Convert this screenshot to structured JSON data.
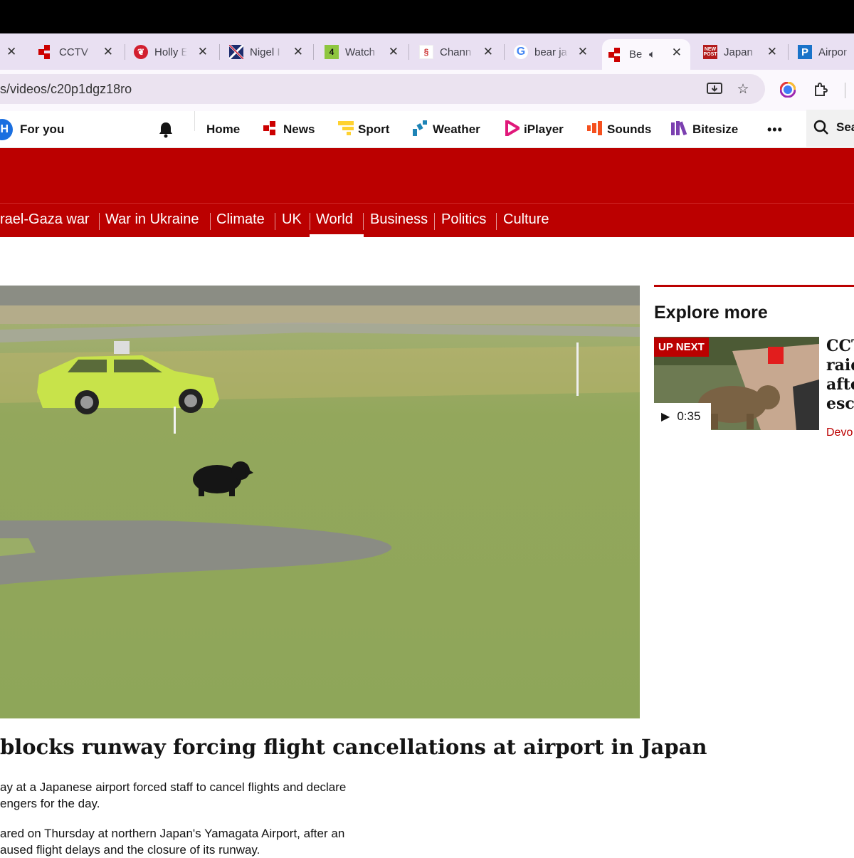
{
  "browser": {
    "tabs": [
      {
        "title": "CCTV",
        "favicon": "bbc-news-icon"
      },
      {
        "title": "Holly E",
        "favicon": "red-heart-icon"
      },
      {
        "title": "Nigel I",
        "favicon": "union-flag-icon"
      },
      {
        "title": "Watch",
        "favicon": "channel-4-icon"
      },
      {
        "title": "Chann",
        "favicon": "channel-logo-icon"
      },
      {
        "title": "bear ja",
        "favicon": "google-icon"
      },
      {
        "title": "Be",
        "favicon": "bbc-news-icon",
        "active": true
      },
      {
        "title": "Japan",
        "favicon": "new-post-icon"
      },
      {
        "title": "Airpor",
        "favicon": "p-logo-icon"
      }
    ],
    "url": "s/videos/c20p1dgz18ro"
  },
  "bbc_nav": {
    "for_you": "For you",
    "home": "Home",
    "news": "News",
    "sport": "Sport",
    "weather": "Weather",
    "iplayer": "iPlayer",
    "sounds": "Sounds",
    "bitesize": "Bitesize",
    "more": "•••",
    "search": "Sea"
  },
  "news_nav": {
    "links": [
      "rael-Gaza war",
      "War in Ukraine",
      "Climate",
      "UK",
      "World",
      "Business",
      "Politics",
      "Culture"
    ],
    "active": "World"
  },
  "article": {
    "headline": "blocks runway forcing flight cancellations at airport in Japan",
    "para1_line1": "ay at a Japanese airport forced staff to cancel flights and declare",
    "para1_line2": "engers for the day.",
    "para2_line1": "ared on Thursday at northern Japan's Yamagata Airport, after an",
    "para2_line2": "aused flight delays and the closure of its runway."
  },
  "sidebar": {
    "heading": "Explore more",
    "up_next": "UP NEXT",
    "duration": "0:35",
    "title": "CCT\nraid\nafte\nesca",
    "tag": "Devo"
  },
  "colors": {
    "bbc_red": "#bb0000",
    "tabstrip": "#e9e0f2"
  }
}
